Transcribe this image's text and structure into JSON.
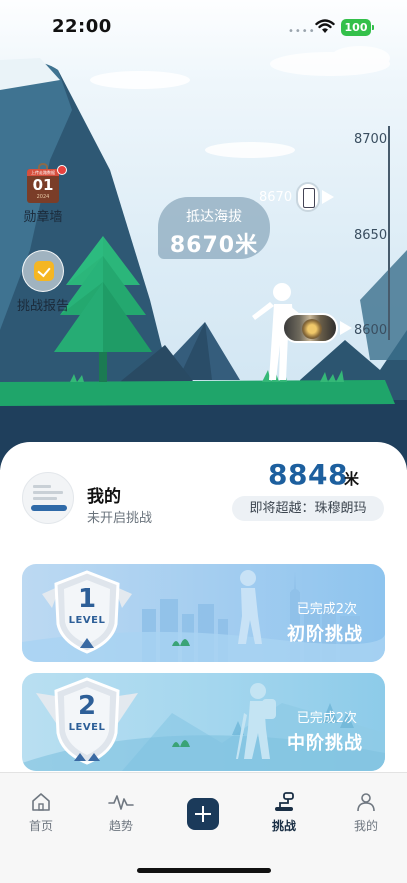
{
  "status_bar": {
    "time": "22:00",
    "battery": "100"
  },
  "hero": {
    "medal_wall_label": "勋章墙",
    "medal_card_top": "上传走路数据",
    "medal_card_number": "01",
    "medal_card_year": "2024",
    "report_label": "挑战报告",
    "bubble_title": "抵达海拔",
    "bubble_value": "8670米",
    "scale_ticks": [
      "8700",
      "8650",
      "8600"
    ],
    "marker_value": "8670"
  },
  "profile": {
    "name": "我的",
    "status": "未开启挑战",
    "altitude": "8848",
    "altitude_unit": "米",
    "next_target": "即将超越：珠穆朗玛"
  },
  "challenges": [
    {
      "level_number": "1",
      "level_word": "LEVEL",
      "completed": "已完成2次",
      "title": "初阶挑战"
    },
    {
      "level_number": "2",
      "level_word": "LEVEL",
      "completed": "已完成2次",
      "title": "中阶挑战"
    }
  ],
  "tabbar": {
    "home": "首页",
    "trend": "趋势",
    "challenge": "挑战",
    "mine": "我的"
  },
  "colors": {
    "accent": "#1d5f9e",
    "grass": "#1fa56a",
    "tab_active": "#1a2f45"
  }
}
